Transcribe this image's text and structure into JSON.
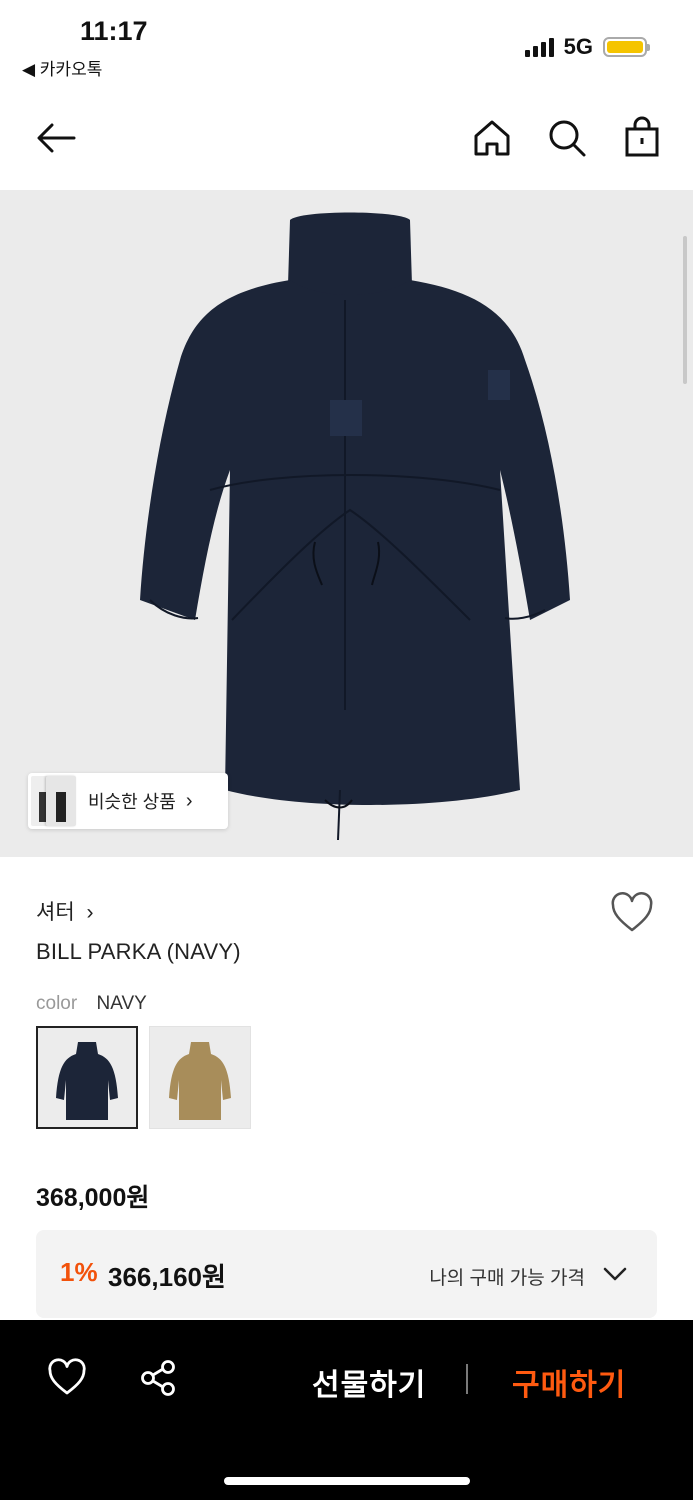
{
  "status": {
    "time": "11:17",
    "back_app": "◀ 카카오톡",
    "network": "5G",
    "battery_color": "#f5c400"
  },
  "header": {
    "icons": [
      "back-arrow-icon",
      "home-icon",
      "search-icon",
      "shopping-bag-icon"
    ]
  },
  "gallery": {
    "similar_label": "비슷한 상품",
    "background": "#ebebeb"
  },
  "product": {
    "brand": "셔터",
    "name": "BILL PARKA (NAVY)",
    "color_label": "color",
    "color_value": "NAVY",
    "color_options": [
      {
        "name": "navy",
        "hex": "#1c2538",
        "selected": true
      },
      {
        "name": "khaki",
        "hex": "#a88d5a",
        "selected": false
      }
    ],
    "price": "368,000원",
    "discount_rate": "1%",
    "discount_price": "366,160원",
    "my_price_label": "나의 구매 가능 가격"
  },
  "bottom_bar": {
    "gift_label": "선물하기",
    "buy_label": "구매하기",
    "accent": "#ff5a10"
  }
}
